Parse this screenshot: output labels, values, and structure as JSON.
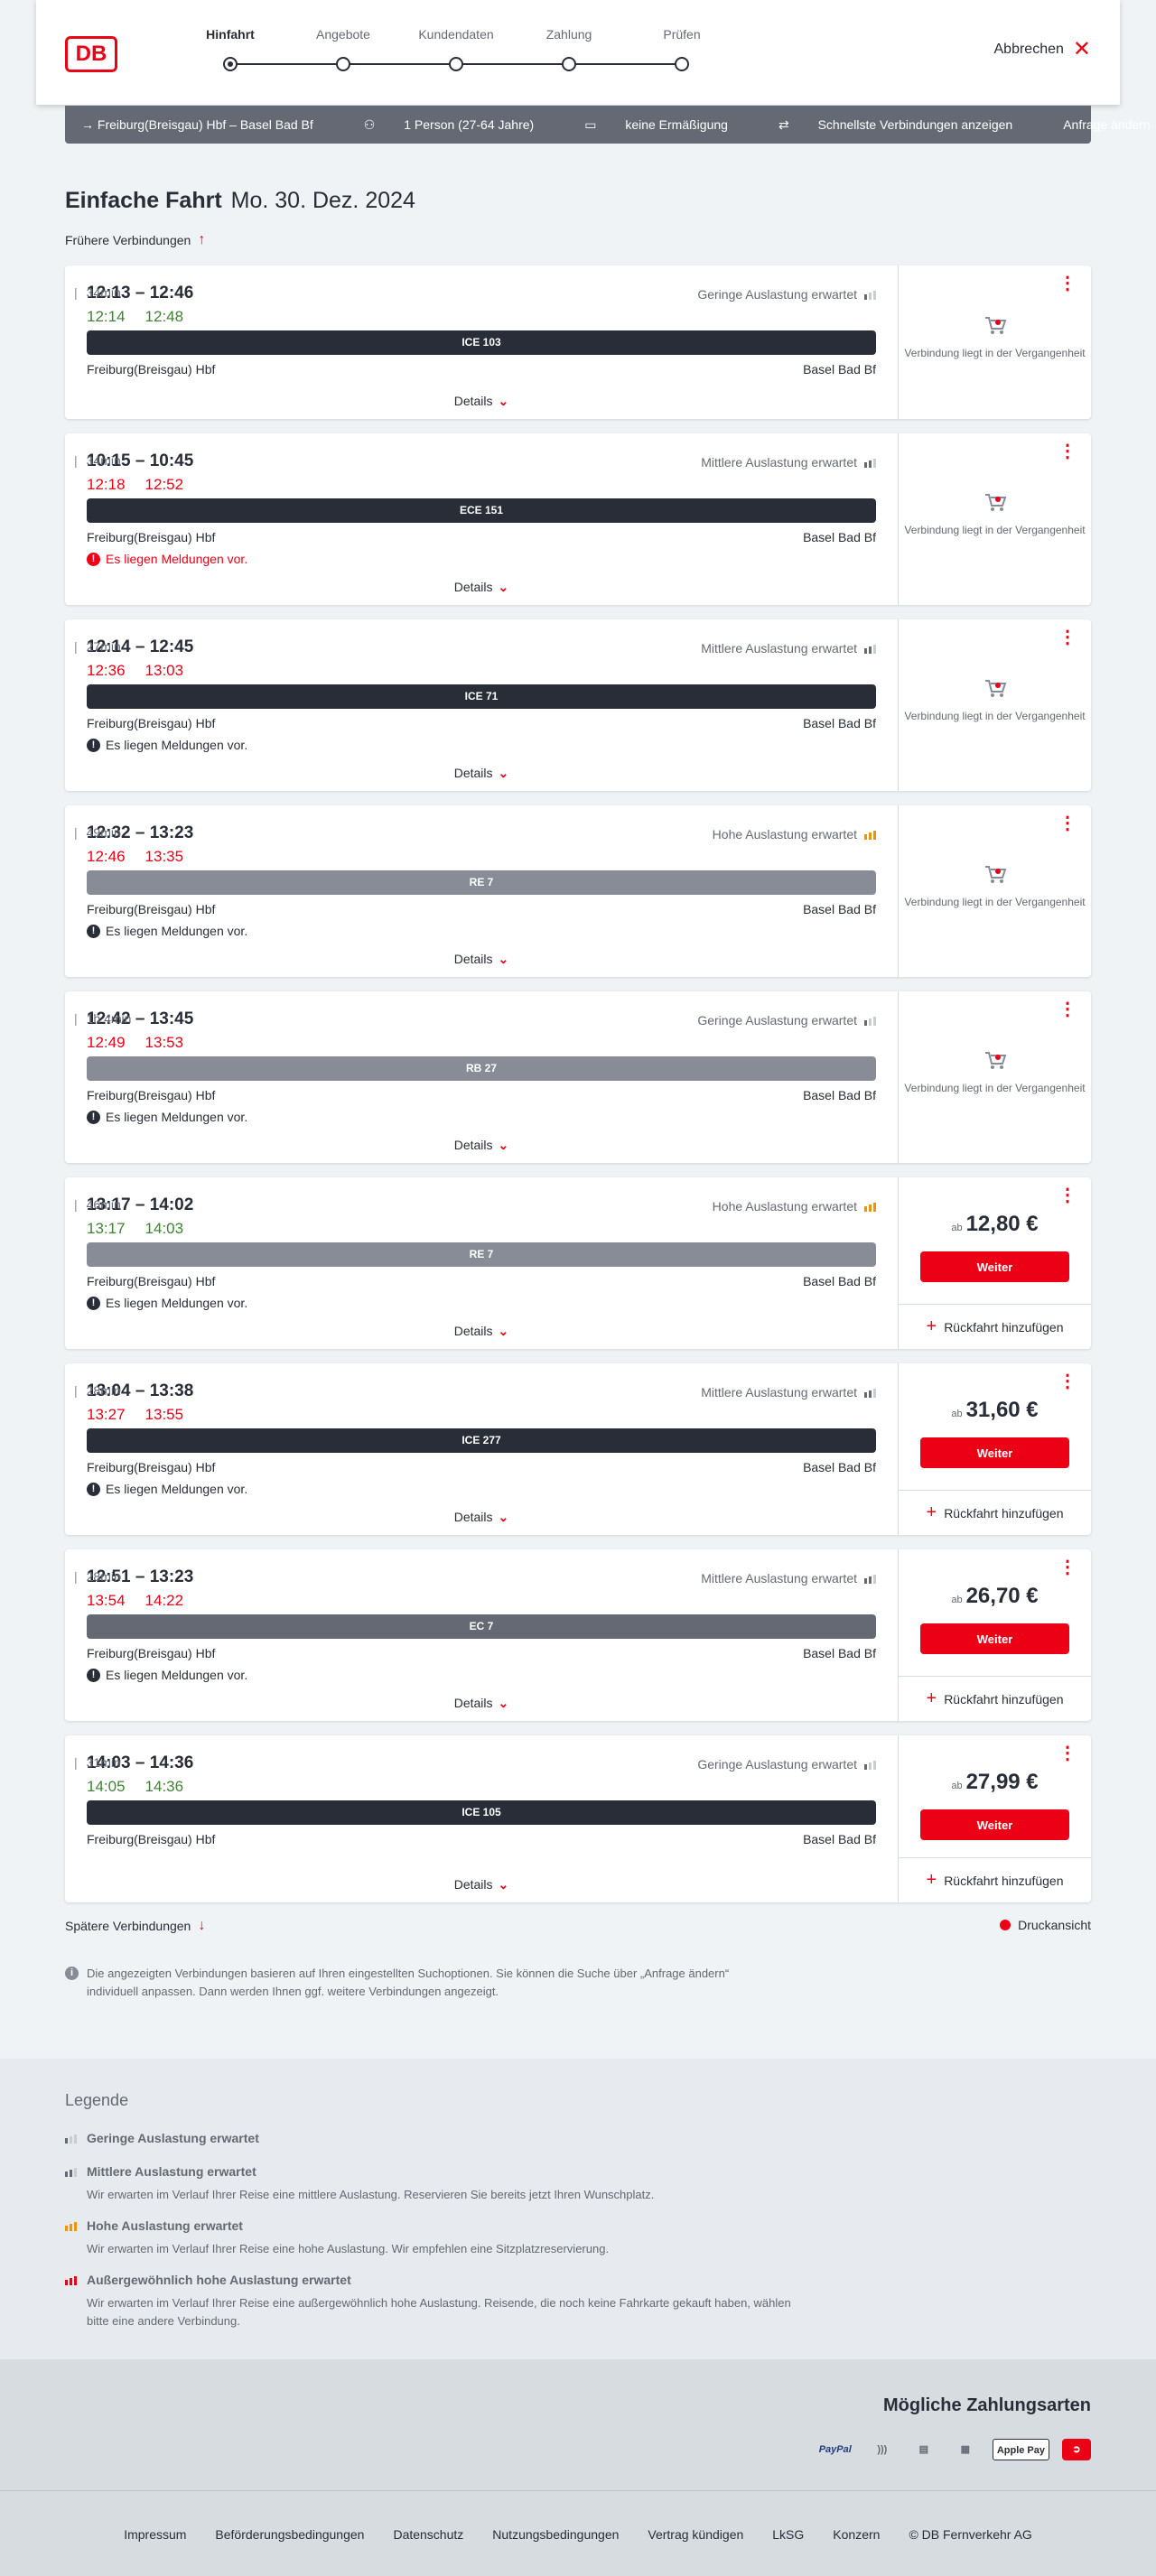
{
  "header": {
    "logo": "DB",
    "steps": [
      "Hinfahrt",
      "Angebote",
      "Kundendaten",
      "Zahlung",
      "Prüfen"
    ],
    "active_step": 0,
    "cancel_label": "Abbrechen"
  },
  "query": {
    "route": "Freiburg(Breisgau) Hbf – Basel Bad Bf",
    "travellers": "1 Person (27-64 Jahre)",
    "discount": "keine Ermäßigung",
    "fastest": "Schnellste Verbindungen anzeigen",
    "change": "Anfrage ändern"
  },
  "title": {
    "type": "Einfache Fahrt",
    "date": "Mo. 30. Dez. 2024"
  },
  "earlier_label": "Frühere Verbindungen",
  "later_label": "Spätere Verbindungen",
  "print_label": "Druckansicht",
  "details_label": "Details",
  "past_label": "Verbindung liegt in der Vergangenheit",
  "from_label": "ab",
  "weiter_label": "Weiter",
  "return_label": "Rückfahrt hinzufügen",
  "connections": [
    {
      "time": "12:13 – 12:46",
      "duration": "34min",
      "rt_dep": "12:14",
      "rt_arr": "12:48",
      "rt_color": "green",
      "load": "Geringe Auslastung erwartet",
      "load_level": "low",
      "train": "ICE 103",
      "train_type": "ice",
      "from": "Freiburg(Breisgau) Hbf",
      "to": "Basel Bad Bf",
      "message": "",
      "status": "past"
    },
    {
      "time": "10:15 – 10:45",
      "duration": "34min",
      "rt_dep": "12:18",
      "rt_arr": "12:52",
      "rt_color": "red",
      "load": "Mittlere Auslastung erwartet",
      "load_level": "mid",
      "train": "ECE 151",
      "train_type": "ice",
      "from": "Freiburg(Breisgau) Hbf",
      "to": "Basel Bad Bf",
      "message": "Es liegen Meldungen vor.",
      "message_red": true,
      "status": "past"
    },
    {
      "time": "12:14 – 12:45",
      "duration": "27min",
      "rt_dep": "12:36",
      "rt_arr": "13:03",
      "rt_color": "red",
      "load": "Mittlere Auslastung erwartet",
      "load_level": "mid",
      "train": "ICE 71",
      "train_type": "ice",
      "from": "Freiburg(Breisgau) Hbf",
      "to": "Basel Bad Bf",
      "message": "Es liegen Meldungen vor.",
      "message_red": false,
      "status": "past"
    },
    {
      "time": "12:32 – 13:23",
      "duration": "49min",
      "rt_dep": "12:46",
      "rt_arr": "13:35",
      "rt_color": "red",
      "load": "Hohe Auslastung erwartet",
      "load_level": "high",
      "train": "RE 7",
      "train_type": "re",
      "from": "Freiburg(Breisgau) Hbf",
      "to": "Basel Bad Bf",
      "message": "Es liegen Meldungen vor.",
      "message_red": false,
      "status": "past"
    },
    {
      "time": "12:42 – 13:45",
      "duration": "1h 4min",
      "rt_dep": "12:49",
      "rt_arr": "13:53",
      "rt_color": "red",
      "load": "Geringe Auslastung erwartet",
      "load_level": "low",
      "train": "RB 27",
      "train_type": "re",
      "from": "Freiburg(Breisgau) Hbf",
      "to": "Basel Bad Bf",
      "message": "Es liegen Meldungen vor.",
      "message_red": false,
      "status": "past"
    },
    {
      "time": "13:17 – 14:02",
      "duration": "46min",
      "rt_dep": "13:17",
      "rt_arr": "14:03",
      "rt_color": "green",
      "load": "Hohe Auslastung erwartet",
      "load_level": "high",
      "train": "RE 7",
      "train_type": "re",
      "from": "Freiburg(Breisgau) Hbf",
      "to": "Basel Bad Bf",
      "message": "Es liegen Meldungen vor.",
      "message_red": false,
      "status": "price",
      "price": "12,80 €"
    },
    {
      "time": "13:04 – 13:38",
      "duration": "28min",
      "rt_dep": "13:27",
      "rt_arr": "13:55",
      "rt_color": "red",
      "load": "Mittlere Auslastung erwartet",
      "load_level": "mid",
      "train": "ICE 277",
      "train_type": "ice",
      "from": "Freiburg(Breisgau) Hbf",
      "to": "Basel Bad Bf",
      "message": "Es liegen Meldungen vor.",
      "message_red": false,
      "status": "price",
      "price": "31,60 €"
    },
    {
      "time": "12:51 – 13:23",
      "duration": "28min",
      "rt_dep": "13:54",
      "rt_arr": "14:22",
      "rt_color": "red",
      "load": "Mittlere Auslastung erwartet",
      "load_level": "mid",
      "train": "EC 7",
      "train_type": "ec",
      "from": "Freiburg(Breisgau) Hbf",
      "to": "Basel Bad Bf",
      "message": "Es liegen Meldungen vor.",
      "message_red": false,
      "status": "price",
      "price": "26,70 €"
    },
    {
      "time": "14:03 – 14:36",
      "duration": "31min",
      "rt_dep": "14:05",
      "rt_arr": "14:36",
      "rt_color": "green",
      "load": "Geringe Auslastung erwartet",
      "load_level": "low",
      "train": "ICE 105",
      "train_type": "ice",
      "from": "Freiburg(Breisgau) Hbf",
      "to": "Basel Bad Bf",
      "message": "",
      "status": "price",
      "price": "27,99 €"
    }
  ],
  "info_text": "Die angezeigten Verbindungen basieren auf Ihren eingestellten Suchoptionen. Sie können die Suche über „Anfrage ändern“ individuell anpassen. Dann werden Ihnen ggf. weitere Verbindungen angezeigt.",
  "legend": {
    "title": "Legende",
    "items": [
      {
        "title": "Geringe Auslastung erwartet",
        "desc": "",
        "level": "low"
      },
      {
        "title": "Mittlere Auslastung erwartet",
        "desc": "Wir erwarten im Verlauf Ihrer Reise eine mittlere Auslastung. Reservieren Sie bereits jetzt Ihren Wunschplatz.",
        "level": "mid"
      },
      {
        "title": "Hohe Auslastung erwartet",
        "desc": "Wir erwarten im Verlauf Ihrer Reise eine hohe Auslastung. Wir empfehlen eine Sitzplatzreservierung.",
        "level": "high"
      },
      {
        "title": "Außergewöhnlich hohe Auslastung erwartet",
        "desc": "Wir erwarten im Verlauf Ihrer Reise eine außergewöhnlich hohe Auslastung. Reisende, die noch keine Fahrkarte gekauft haben, wählen bitte eine andere Verbindung.",
        "level": "extreme"
      }
    ]
  },
  "payment": {
    "title": "Mögliche Zahlungsarten",
    "methods": [
      "PayPal",
      "Apple Pay"
    ]
  },
  "footer": {
    "links": [
      "Impressum",
      "Beförderungsbedingungen",
      "Datenschutz",
      "Nutzungsbedingungen",
      "Vertrag kündigen",
      "LkSG",
      "Konzern",
      "© DB Fernverkehr AG"
    ]
  },
  "colors": {
    "brand_red": "#ec0016",
    "on_time_green": "#408335",
    "high_load_orange": "#f39200"
  }
}
